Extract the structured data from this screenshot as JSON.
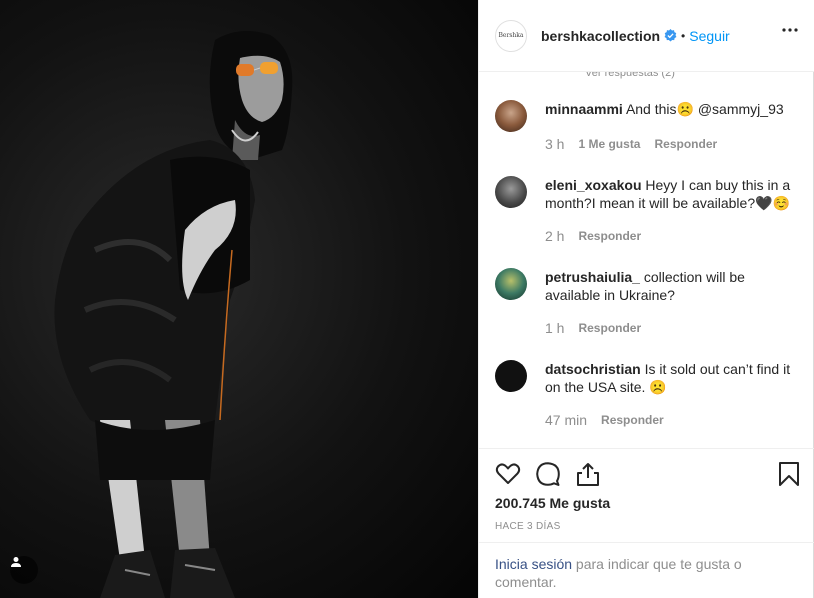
{
  "post": {
    "account": "bershkacollection",
    "account_avatar_text": "Bershka",
    "follow_label": "Seguir",
    "separator": "•"
  },
  "comments_header": {
    "view_replies": "Ver respuestas (2)"
  },
  "comments": [
    {
      "user": "minnaammi",
      "text": "And this☹️ @sammyj_93",
      "time": "3 h",
      "likes": "1 Me gusta",
      "reply": "Responder"
    },
    {
      "user": "eleni_xoxakou",
      "text": "Heyy I can buy this in a month?I mean it will be available?🖤☺️",
      "time": "2 h",
      "likes": "",
      "reply": "Responder"
    },
    {
      "user": "petrushaiulia_",
      "text": "collection will be available in Ukraine?",
      "time": "1 h",
      "likes": "",
      "reply": "Responder"
    },
    {
      "user": "datsochristian",
      "text": "Is it sold out can’t find it on the USA site. ☹️",
      "time": "47 min",
      "likes": "",
      "reply": "Responder"
    }
  ],
  "stats": {
    "likes": "200.745 Me gusta",
    "date": "HACE 3 DÍAS"
  },
  "login": {
    "link": "Inicia sesión",
    "rest": " para indicar que te gusta o comentar."
  },
  "icons": {
    "like": "heart-icon",
    "comment": "comment-icon",
    "share": "share-icon",
    "save": "bookmark-icon",
    "more": "more-icon",
    "verified": "verified-badge-icon",
    "tag": "user-tag-icon"
  },
  "colors": {
    "link_blue": "#0095f6",
    "verified_blue": "#3897f0",
    "login_link": "#385185",
    "muted": "#8e8e8e"
  }
}
